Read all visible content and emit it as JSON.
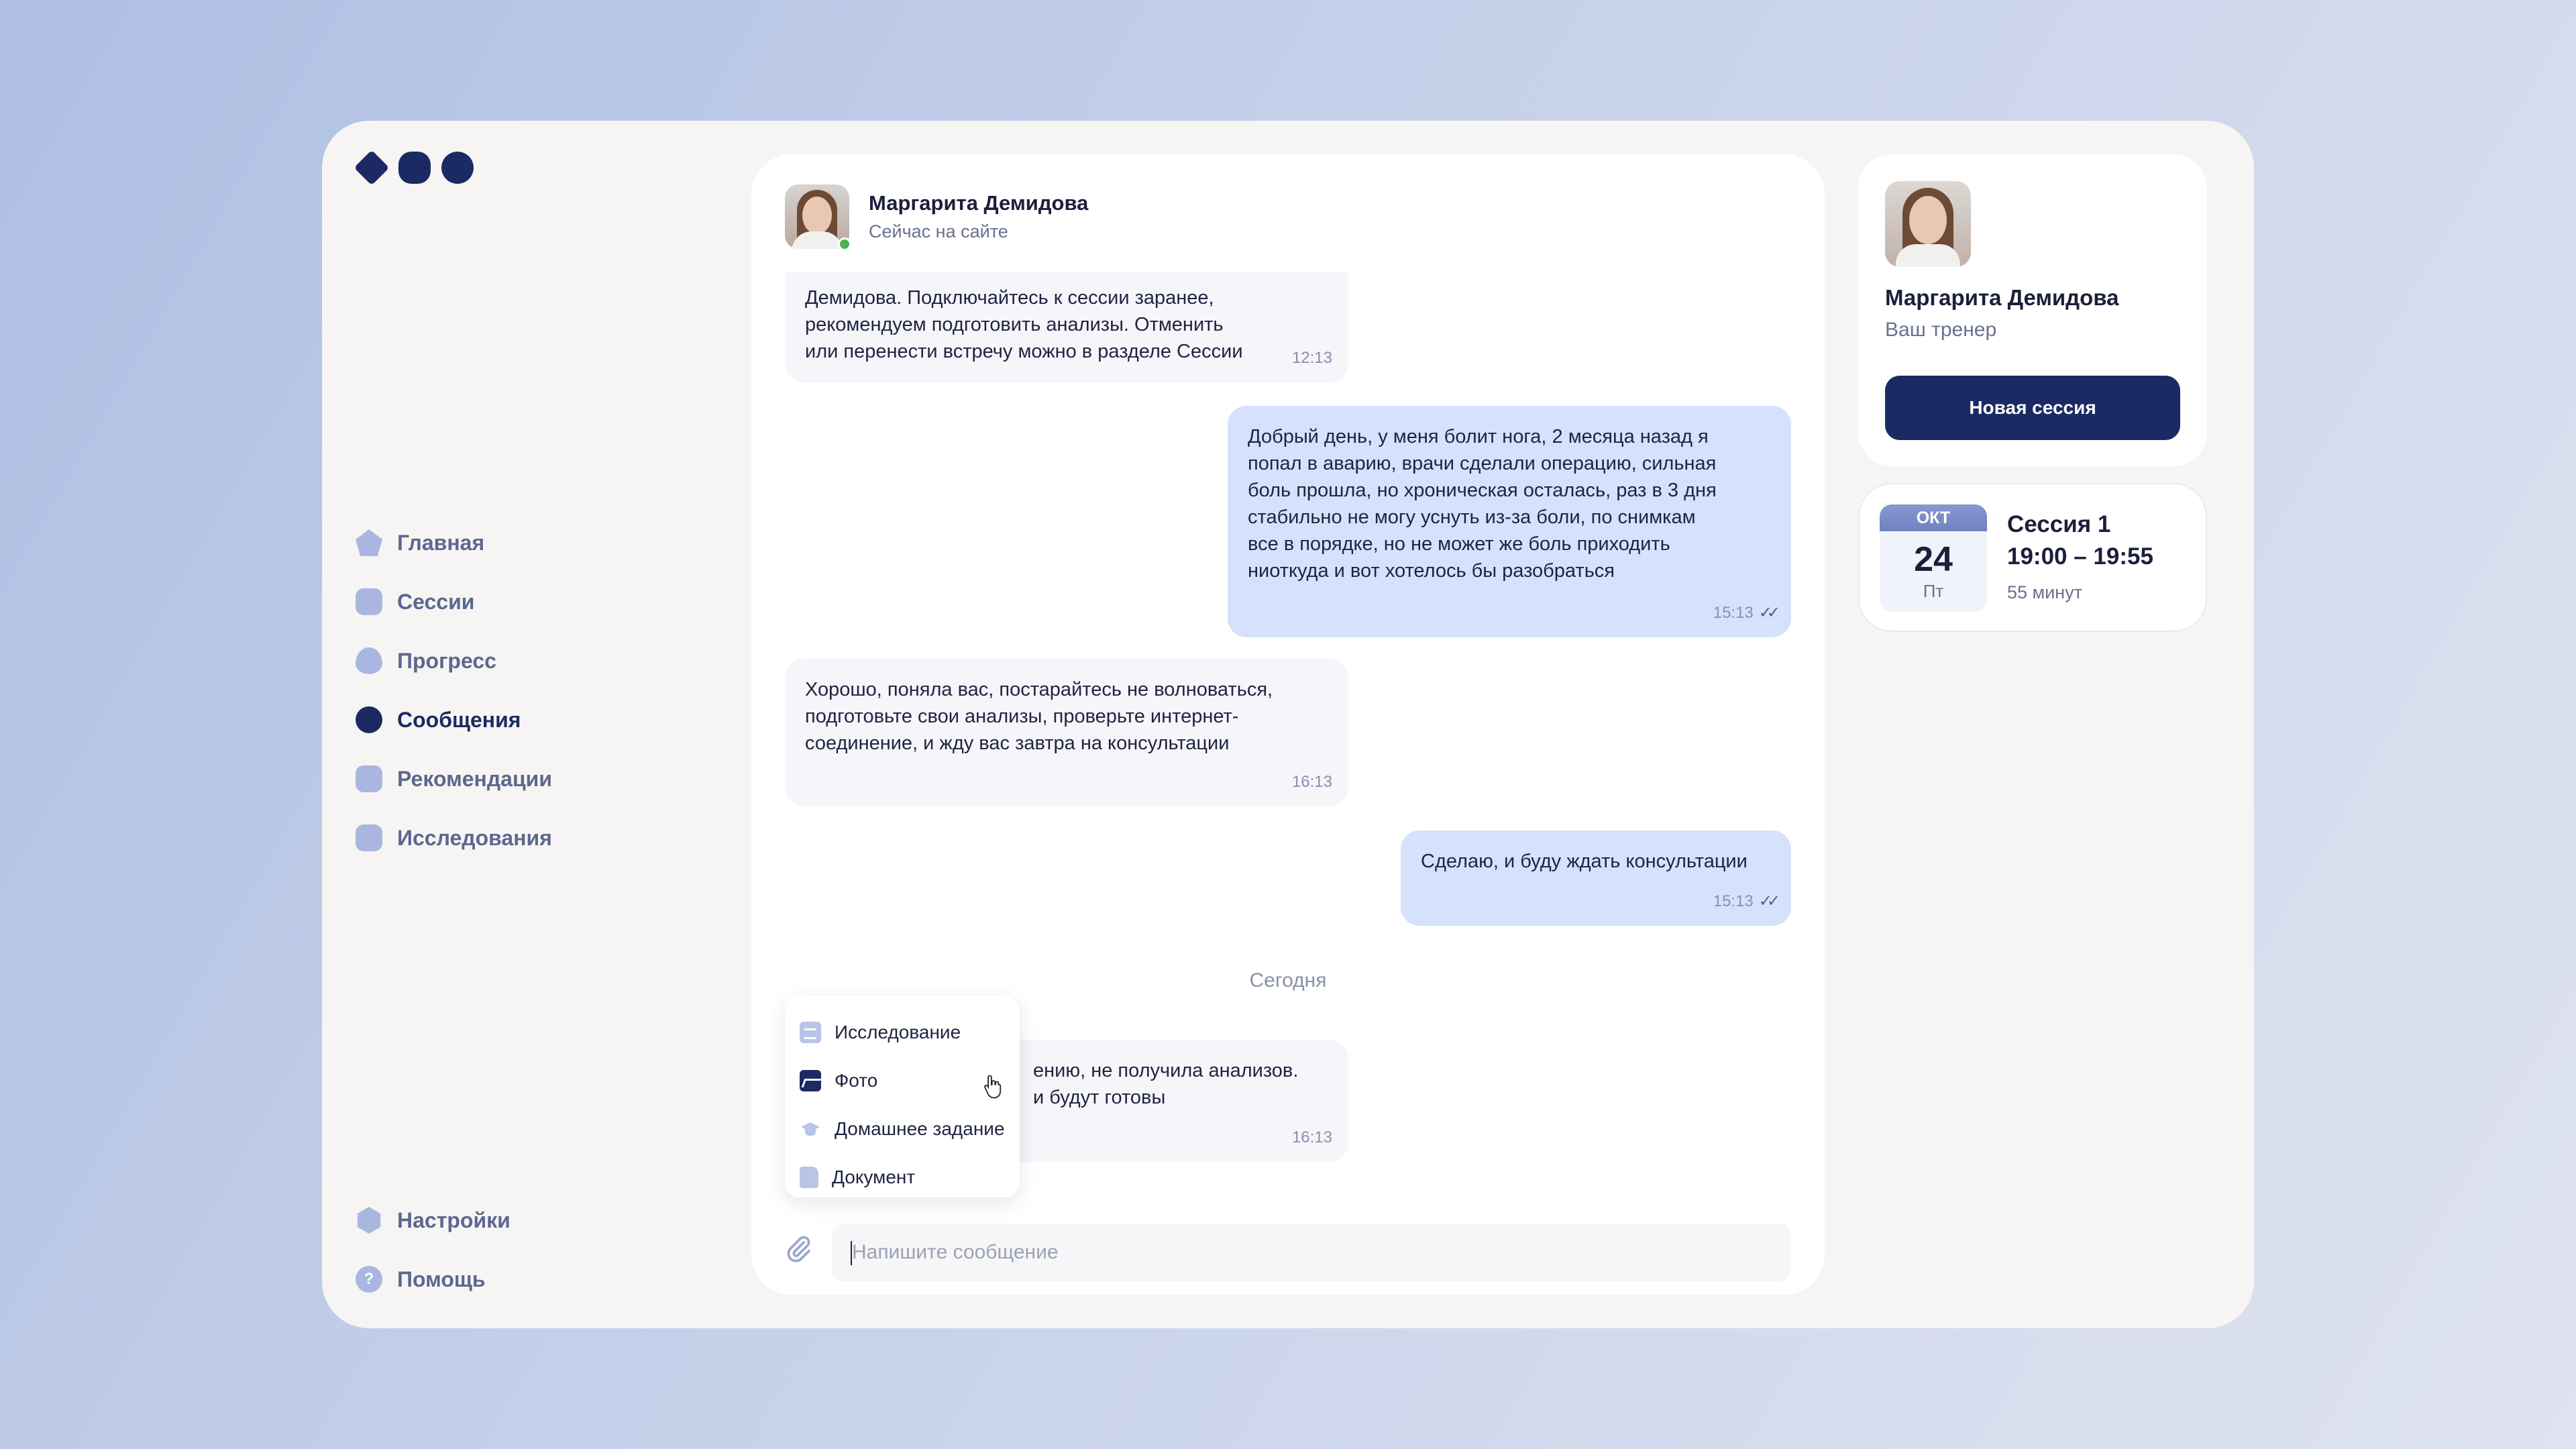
{
  "sidebar": {
    "items": [
      {
        "label": "Главная",
        "icon": "home-icon"
      },
      {
        "label": "Сессии",
        "icon": "video-icon"
      },
      {
        "label": "Прогресс",
        "icon": "progress-icon"
      },
      {
        "label": "Сообщения",
        "icon": "chat-icon",
        "active": true
      },
      {
        "label": "Рекомендации",
        "icon": "recommendations-icon"
      },
      {
        "label": "Исследования",
        "icon": "research-icon"
      }
    ],
    "bottom": [
      {
        "label": "Настройки",
        "icon": "settings-icon"
      },
      {
        "label": "Помощь",
        "icon": "help-icon",
        "glyph": "?"
      }
    ]
  },
  "chat": {
    "contact_name": "Маргарита Демидова",
    "contact_status": "Сейчас на сайте",
    "messages": [
      {
        "direction": "in",
        "text": "Демидова. Подключайтесь к сессии заранее,\nрекомендуем подготовить анализы. Отменить\nили перенести встречу можно в разделе Сессии",
        "time": "12:13"
      },
      {
        "direction": "out",
        "text": "Добрый день, у меня болит нога, 2 месяца назад я\nпопал в аварию, врачи сделали операцию, сильная\nболь прошла, но хроническая осталась, раз в 3 дня\nстабильно не могу уснуть из-за боли, по снимкам\nвсе в порядке, но не может же боль приходить\nниоткуда и вот хотелось бы разобраться",
        "time": "15:13"
      },
      {
        "direction": "in",
        "text": "Хорошо, поняла вас, постарайтесь не волноваться,\nподготовьте свои анализы, проверьте интернет-\nсоединение, и жду вас завтра на консультации",
        "time": "16:13"
      },
      {
        "direction": "out",
        "text": "Сделаю, и буду ждать консультации",
        "time": "15:13"
      },
      {
        "direction": "in",
        "text": "ению, не получила анализов.\nи будут готовы",
        "time": "16:13"
      }
    ],
    "date_separator": "Сегодня",
    "read_mark": "✓✓",
    "input_placeholder": "Напишите сообщение"
  },
  "attach_menu": {
    "items": [
      {
        "label": "Исследование",
        "icon": "research-icon"
      },
      {
        "label": "Фото",
        "icon": "photo-icon"
      },
      {
        "label": "Домашнее задание",
        "icon": "homework-icon"
      },
      {
        "label": "Документ",
        "icon": "document-icon"
      }
    ]
  },
  "profile": {
    "name": "Маргарита Демидова",
    "role": "Ваш тренер",
    "button_label": "Новая сессия"
  },
  "session": {
    "month": "ОКТ",
    "day": "24",
    "weekday": "Пт",
    "title": "Сессия 1",
    "time": "19:00 – 19:55",
    "duration": "55 минут"
  },
  "colors": {
    "accent": "#1c2a63",
    "outgoing_bubble": "#d6e1fb",
    "incoming_bubble": "#f5f5fa",
    "online": "#4caf50"
  }
}
